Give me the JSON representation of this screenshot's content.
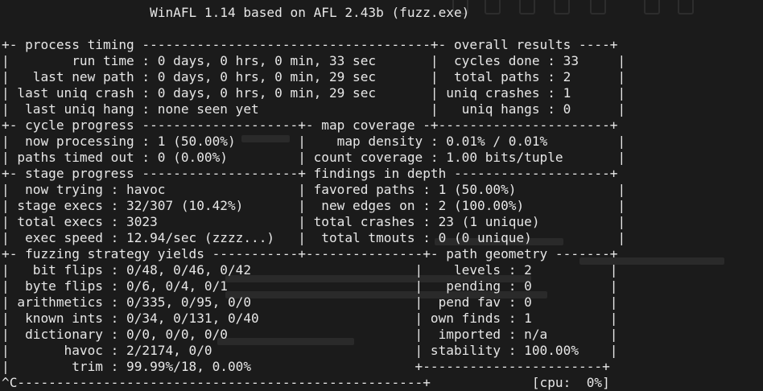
{
  "lines": [
    "                   WinAFL 1.14 based on AFL 2.43b (fuzz.exe)",
    "",
    "+- process timing -------------------------------------+- overall results ----+",
    "|        run time : 0 days, 0 hrs, 0 min, 33 sec       |  cycles done : 33     |",
    "|   last new path : 0 days, 0 hrs, 0 min, 29 sec       |  total paths : 2      |",
    "| last uniq crash : 0 days, 0 hrs, 0 min, 29 sec       | uniq crashes : 1      |",
    "|  last uniq hang : none seen yet                      |   uniq hangs : 0      |",
    "+- cycle progress --------------------+- map coverage -+----------------------+",
    "|  now processing : 1 (50.00%)        |    map density : 0.01% / 0.01%         |",
    "| paths timed out : 0 (0.00%)         | count coverage : 1.00 bits/tuple       |",
    "+- stage progress --------------------+ findings in depth --------------------+",
    "|  now trying : havoc                 | favored paths : 1 (50.00%)             |",
    "| stage execs : 32/307 (10.42%)       |  new edges on : 2 (100.00%)            |",
    "| total execs : 3023                  | total crashes : 23 (1 unique)          |",
    "|  exec speed : 12.94/sec (zzzz...)   |  total tmouts : 0 (0 unique)           |",
    "+- fuzzing strategy yields -----------+---------------+- path geometry -------+",
    "|   bit flips : 0/48, 0/46, 0/42                     |    levels : 2          |",
    "|  byte flips : 0/6, 0/4, 0/1                        |   pending : 0          |",
    "| arithmetics : 0/335, 0/95, 0/0                     |  pend fav : 0          |",
    "|  known ints : 0/34, 0/131, 0/40                    | own finds : 1          |",
    "|  dictionary : 0/0, 0/0, 0/0                        |  imported : n/a        |",
    "|       havoc : 2/2174, 0/0                          | stability : 100.00%    |",
    "|        trim : 99.99%/18, 0.00%                     +-----------------------+",
    "^C----------------------------------------------------+             [cpu:  0%]"
  ]
}
